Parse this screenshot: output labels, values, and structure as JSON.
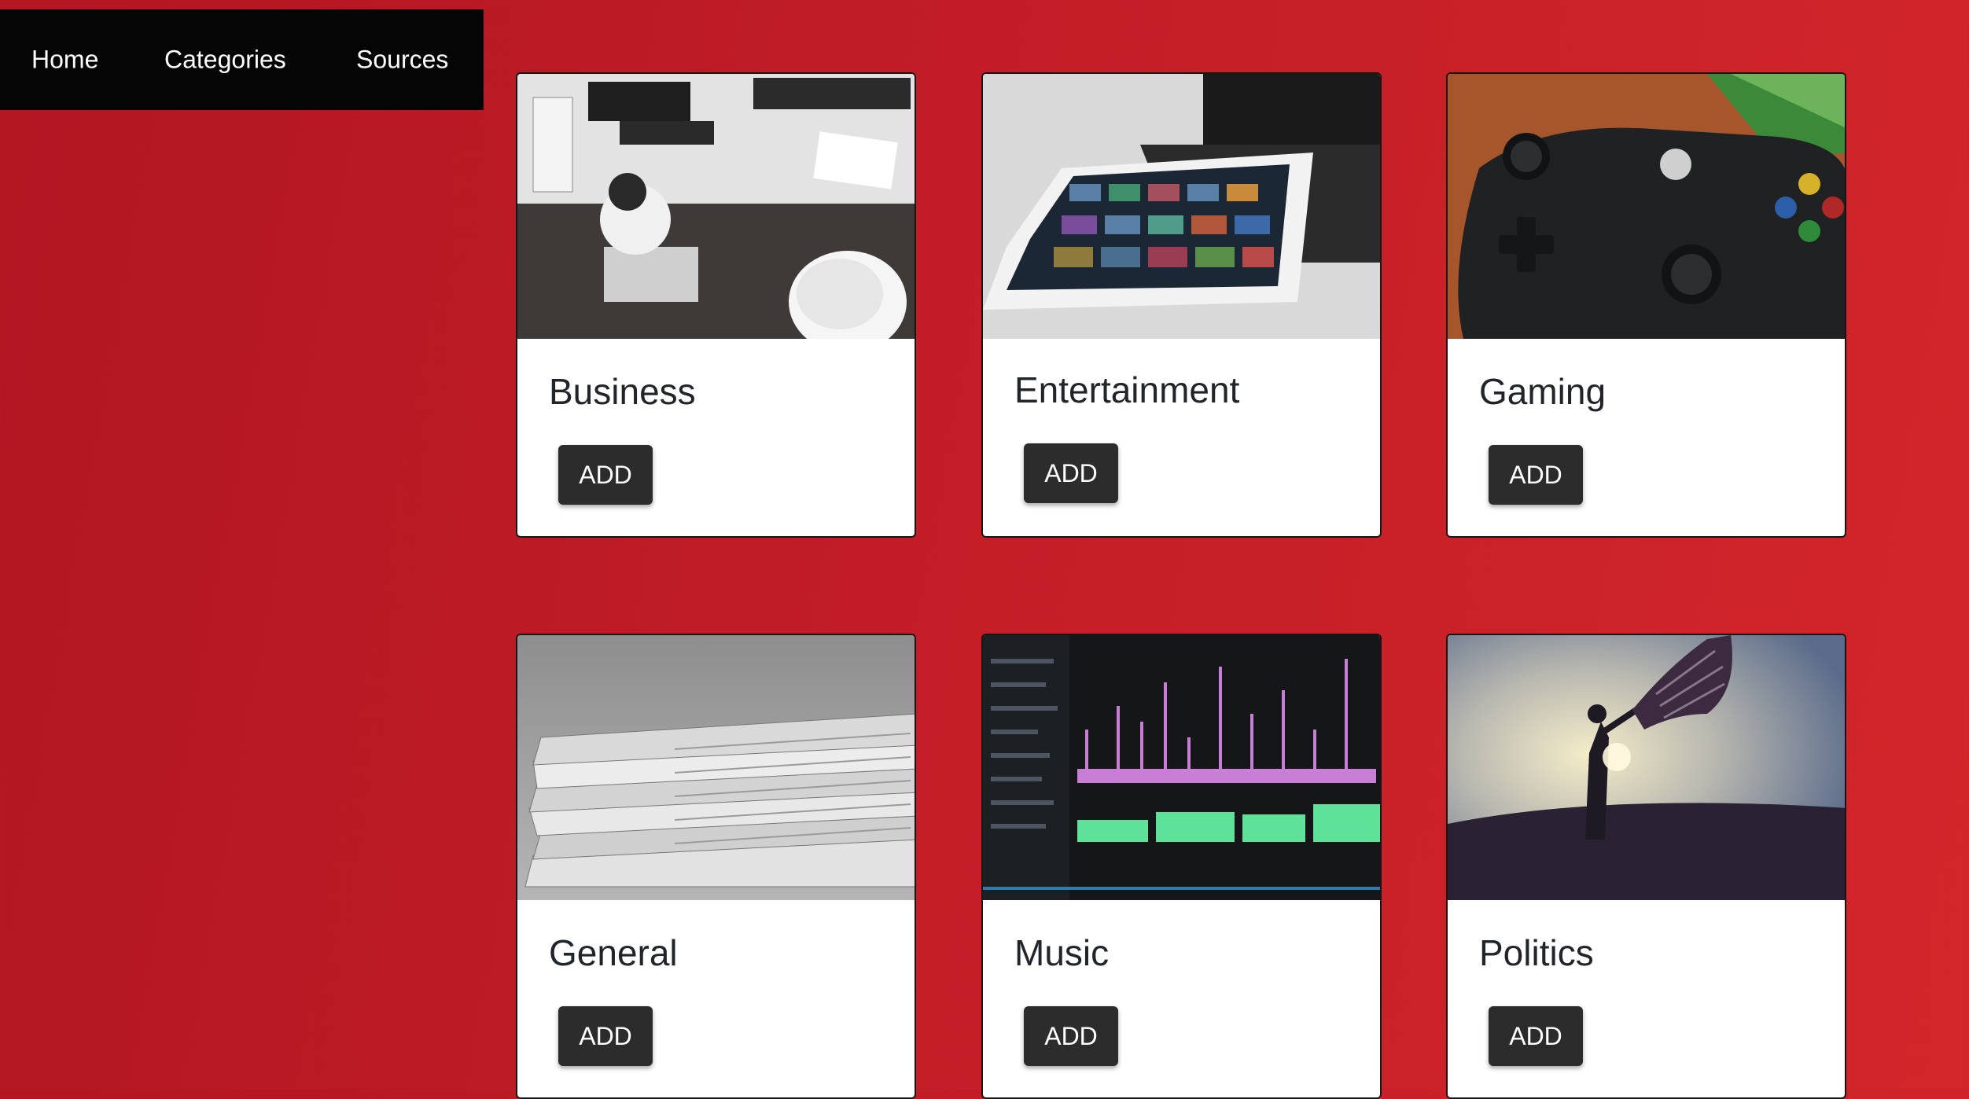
{
  "nav": {
    "home": "Home",
    "categories": "Categories",
    "sources": "Sources"
  },
  "cards": [
    {
      "title": "Business",
      "button": "ADD",
      "image": "office-desk-photo"
    },
    {
      "title": "Entertainment",
      "button": "ADD",
      "image": "tablet-streaming-photo"
    },
    {
      "title": "Gaming",
      "button": "ADD",
      "image": "game-controller-photo"
    },
    {
      "title": "General",
      "button": "ADD",
      "image": "newspaper-stack-photo"
    },
    {
      "title": "Music",
      "button": "ADD",
      "image": "audio-editor-photo"
    },
    {
      "title": "Politics",
      "button": "ADD",
      "image": "flag-silhouette-photo"
    }
  ],
  "colors": {
    "background": "#c21d27",
    "navbar": "#050505",
    "button": "#2c2c2c",
    "card": "#ffffff"
  }
}
